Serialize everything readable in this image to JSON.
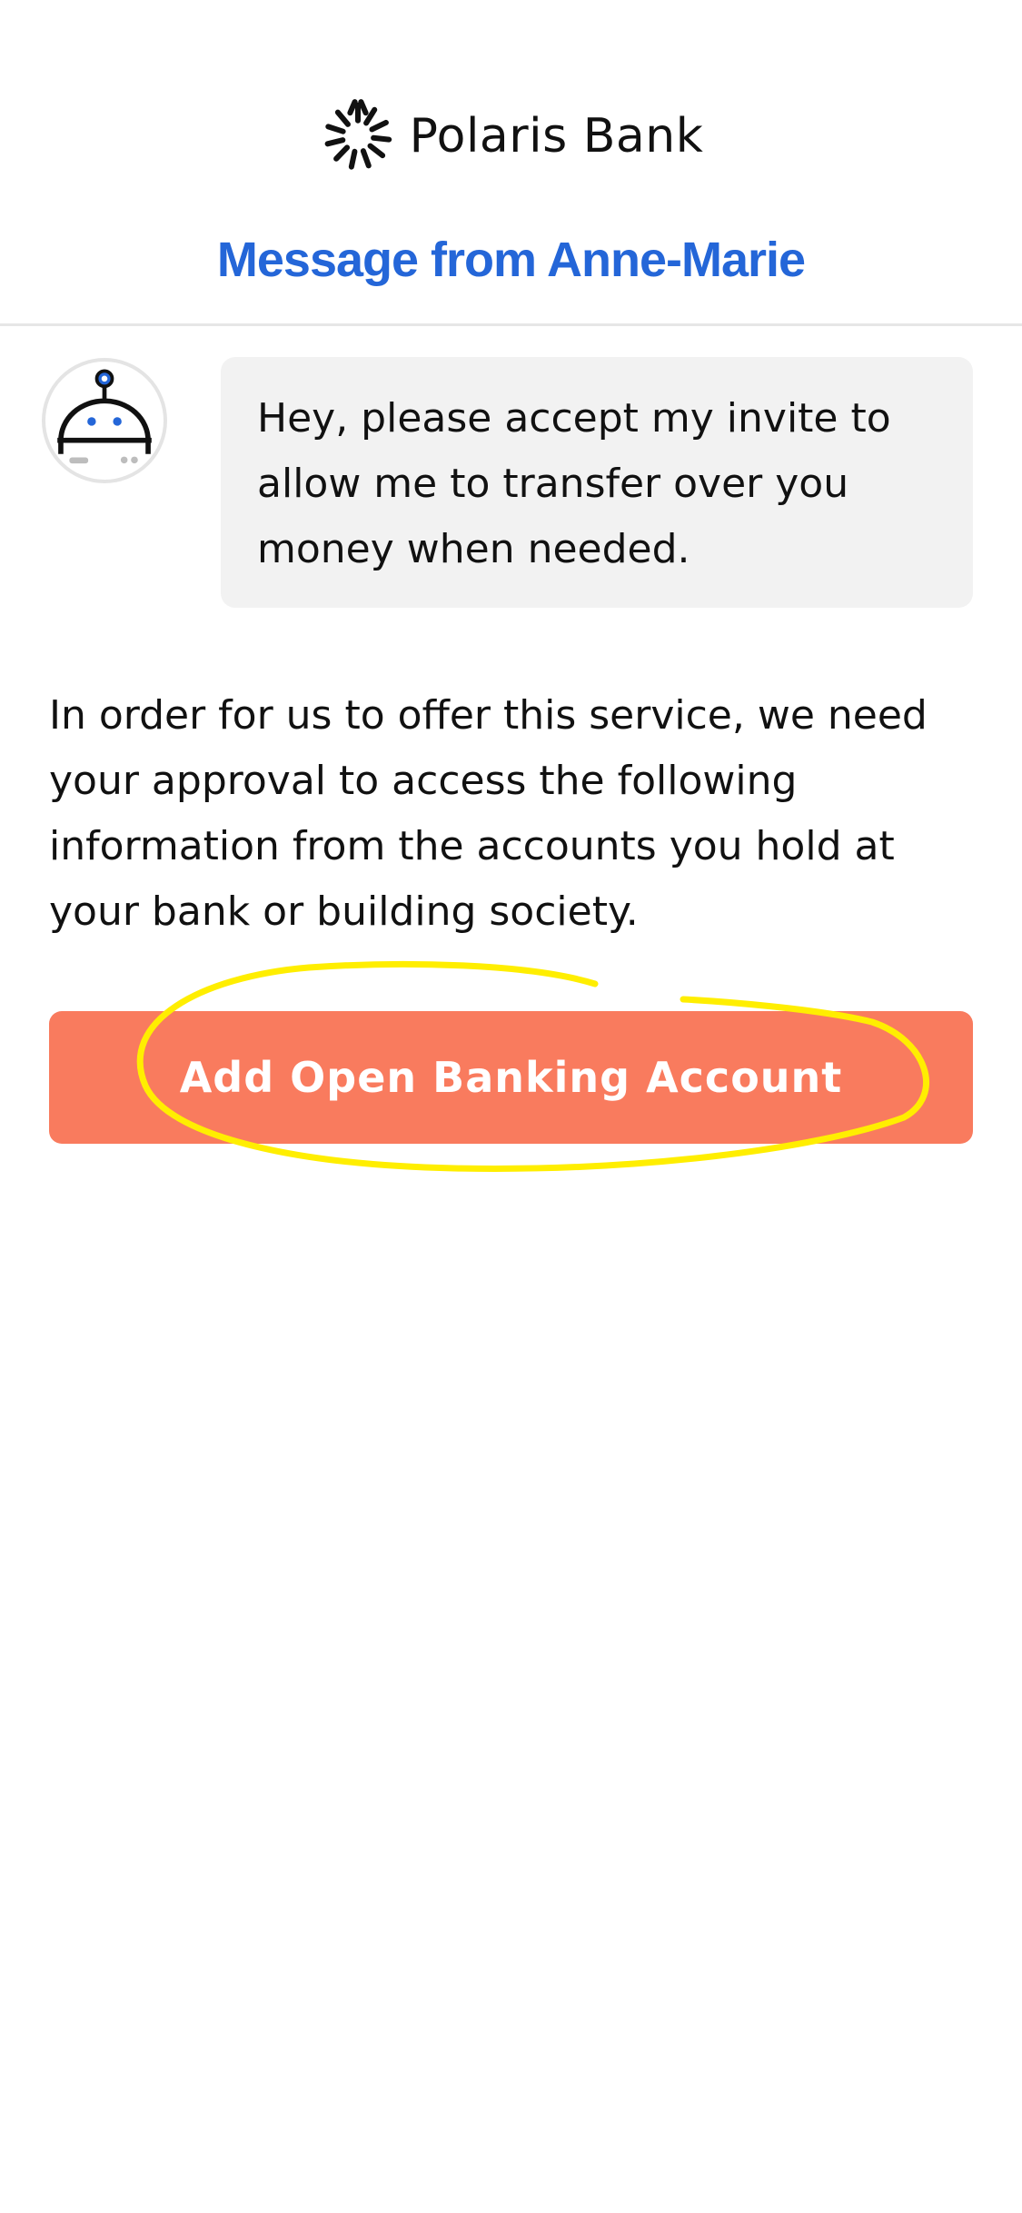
{
  "header": {
    "brand_name": "Polaris Bank",
    "logo_icon": "sunburst-logo-icon",
    "title": "Message from Anne-Marie"
  },
  "message": {
    "avatar_icon": "robot-avatar-icon",
    "text": "Hey, please accept my invite to allow me to transfer over you money when needed."
  },
  "body": {
    "text": "In order for us to offer this service, we need your approval to access the following information from the accounts you hold at your bank or building society."
  },
  "cta": {
    "label": "Add Open Banking Account"
  },
  "colors": {
    "accent_blue": "#2466d8",
    "cta_background": "#f97b5e",
    "bubble_background": "#f2f2f2",
    "annotation_yellow": "#ffee00"
  }
}
